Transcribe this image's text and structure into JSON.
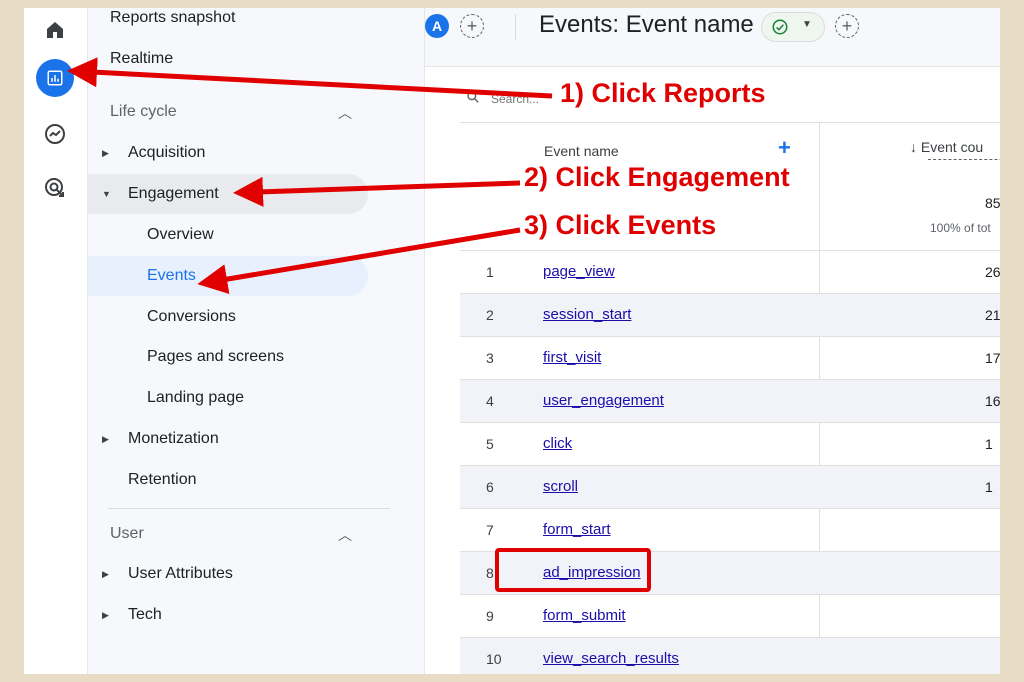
{
  "colors": {
    "accent": "#1a73e8",
    "annotation": "#e00000",
    "link": "#1a0dab",
    "background": "#e9dcc7"
  },
  "rail": {
    "icons": [
      "home-icon",
      "reports-icon",
      "explore-icon",
      "advertising-icon"
    ]
  },
  "nav": {
    "top_items": [
      "Reports snapshot",
      "Realtime"
    ],
    "lifecycle": {
      "label": "Life cycle",
      "items": {
        "acquisition": "Acquisition",
        "engagement": "Engagement",
        "overview": "Overview",
        "events": "Events",
        "conversions": "Conversions",
        "pages": "Pages and screens",
        "landing": "Landing page",
        "monetization": "Monetization",
        "retention": "Retention"
      }
    },
    "user": {
      "label": "User",
      "items": {
        "attributes": "User Attributes",
        "tech": "Tech"
      }
    }
  },
  "header": {
    "avatar_letter": "A",
    "title": "Events: Event name"
  },
  "table": {
    "search_placeholder": "Search...",
    "col_name": "Event name",
    "col_count": "↓ Event cou",
    "total_value": "85",
    "total_pct": "100% of tot",
    "rows": [
      {
        "idx": "1",
        "name": "page_view",
        "val": "26"
      },
      {
        "idx": "2",
        "name": "session_start",
        "val": "21"
      },
      {
        "idx": "3",
        "name": "first_visit",
        "val": "17"
      },
      {
        "idx": "4",
        "name": "user_engagement",
        "val": "16"
      },
      {
        "idx": "5",
        "name": "click",
        "val": "1"
      },
      {
        "idx": "6",
        "name": "scroll",
        "val": "1"
      },
      {
        "idx": "7",
        "name": "form_start",
        "val": ""
      },
      {
        "idx": "8",
        "name": "ad_impression",
        "val": ""
      },
      {
        "idx": "9",
        "name": "form_submit",
        "val": ""
      },
      {
        "idx": "10",
        "name": "view_search_results",
        "val": ""
      }
    ]
  },
  "annotations": {
    "step1": "1) Click Reports",
    "step2": "2) Click Engagement",
    "step3": "3) Click Events"
  }
}
